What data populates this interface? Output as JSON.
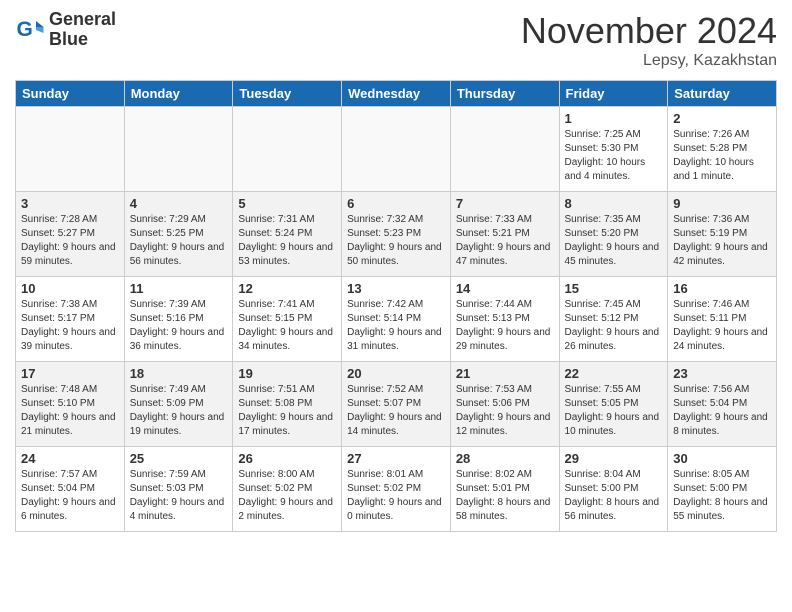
{
  "header": {
    "logo_line1": "General",
    "logo_line2": "Blue",
    "month_title": "November 2024",
    "location": "Lepsy, Kazakhstan"
  },
  "days_of_week": [
    "Sunday",
    "Monday",
    "Tuesday",
    "Wednesday",
    "Thursday",
    "Friday",
    "Saturday"
  ],
  "weeks": [
    [
      {
        "num": "",
        "info": ""
      },
      {
        "num": "",
        "info": ""
      },
      {
        "num": "",
        "info": ""
      },
      {
        "num": "",
        "info": ""
      },
      {
        "num": "",
        "info": ""
      },
      {
        "num": "1",
        "info": "Sunrise: 7:25 AM\nSunset: 5:30 PM\nDaylight: 10 hours and 4 minutes."
      },
      {
        "num": "2",
        "info": "Sunrise: 7:26 AM\nSunset: 5:28 PM\nDaylight: 10 hours and 1 minute."
      }
    ],
    [
      {
        "num": "3",
        "info": "Sunrise: 7:28 AM\nSunset: 5:27 PM\nDaylight: 9 hours and 59 minutes."
      },
      {
        "num": "4",
        "info": "Sunrise: 7:29 AM\nSunset: 5:25 PM\nDaylight: 9 hours and 56 minutes."
      },
      {
        "num": "5",
        "info": "Sunrise: 7:31 AM\nSunset: 5:24 PM\nDaylight: 9 hours and 53 minutes."
      },
      {
        "num": "6",
        "info": "Sunrise: 7:32 AM\nSunset: 5:23 PM\nDaylight: 9 hours and 50 minutes."
      },
      {
        "num": "7",
        "info": "Sunrise: 7:33 AM\nSunset: 5:21 PM\nDaylight: 9 hours and 47 minutes."
      },
      {
        "num": "8",
        "info": "Sunrise: 7:35 AM\nSunset: 5:20 PM\nDaylight: 9 hours and 45 minutes."
      },
      {
        "num": "9",
        "info": "Sunrise: 7:36 AM\nSunset: 5:19 PM\nDaylight: 9 hours and 42 minutes."
      }
    ],
    [
      {
        "num": "10",
        "info": "Sunrise: 7:38 AM\nSunset: 5:17 PM\nDaylight: 9 hours and 39 minutes."
      },
      {
        "num": "11",
        "info": "Sunrise: 7:39 AM\nSunset: 5:16 PM\nDaylight: 9 hours and 36 minutes."
      },
      {
        "num": "12",
        "info": "Sunrise: 7:41 AM\nSunset: 5:15 PM\nDaylight: 9 hours and 34 minutes."
      },
      {
        "num": "13",
        "info": "Sunrise: 7:42 AM\nSunset: 5:14 PM\nDaylight: 9 hours and 31 minutes."
      },
      {
        "num": "14",
        "info": "Sunrise: 7:44 AM\nSunset: 5:13 PM\nDaylight: 9 hours and 29 minutes."
      },
      {
        "num": "15",
        "info": "Sunrise: 7:45 AM\nSunset: 5:12 PM\nDaylight: 9 hours and 26 minutes."
      },
      {
        "num": "16",
        "info": "Sunrise: 7:46 AM\nSunset: 5:11 PM\nDaylight: 9 hours and 24 minutes."
      }
    ],
    [
      {
        "num": "17",
        "info": "Sunrise: 7:48 AM\nSunset: 5:10 PM\nDaylight: 9 hours and 21 minutes."
      },
      {
        "num": "18",
        "info": "Sunrise: 7:49 AM\nSunset: 5:09 PM\nDaylight: 9 hours and 19 minutes."
      },
      {
        "num": "19",
        "info": "Sunrise: 7:51 AM\nSunset: 5:08 PM\nDaylight: 9 hours and 17 minutes."
      },
      {
        "num": "20",
        "info": "Sunrise: 7:52 AM\nSunset: 5:07 PM\nDaylight: 9 hours and 14 minutes."
      },
      {
        "num": "21",
        "info": "Sunrise: 7:53 AM\nSunset: 5:06 PM\nDaylight: 9 hours and 12 minutes."
      },
      {
        "num": "22",
        "info": "Sunrise: 7:55 AM\nSunset: 5:05 PM\nDaylight: 9 hours and 10 minutes."
      },
      {
        "num": "23",
        "info": "Sunrise: 7:56 AM\nSunset: 5:04 PM\nDaylight: 9 hours and 8 minutes."
      }
    ],
    [
      {
        "num": "24",
        "info": "Sunrise: 7:57 AM\nSunset: 5:04 PM\nDaylight: 9 hours and 6 minutes."
      },
      {
        "num": "25",
        "info": "Sunrise: 7:59 AM\nSunset: 5:03 PM\nDaylight: 9 hours and 4 minutes."
      },
      {
        "num": "26",
        "info": "Sunrise: 8:00 AM\nSunset: 5:02 PM\nDaylight: 9 hours and 2 minutes."
      },
      {
        "num": "27",
        "info": "Sunrise: 8:01 AM\nSunset: 5:02 PM\nDaylight: 9 hours and 0 minutes."
      },
      {
        "num": "28",
        "info": "Sunrise: 8:02 AM\nSunset: 5:01 PM\nDaylight: 8 hours and 58 minutes."
      },
      {
        "num": "29",
        "info": "Sunrise: 8:04 AM\nSunset: 5:00 PM\nDaylight: 8 hours and 56 minutes."
      },
      {
        "num": "30",
        "info": "Sunrise: 8:05 AM\nSunset: 5:00 PM\nDaylight: 8 hours and 55 minutes."
      }
    ]
  ]
}
